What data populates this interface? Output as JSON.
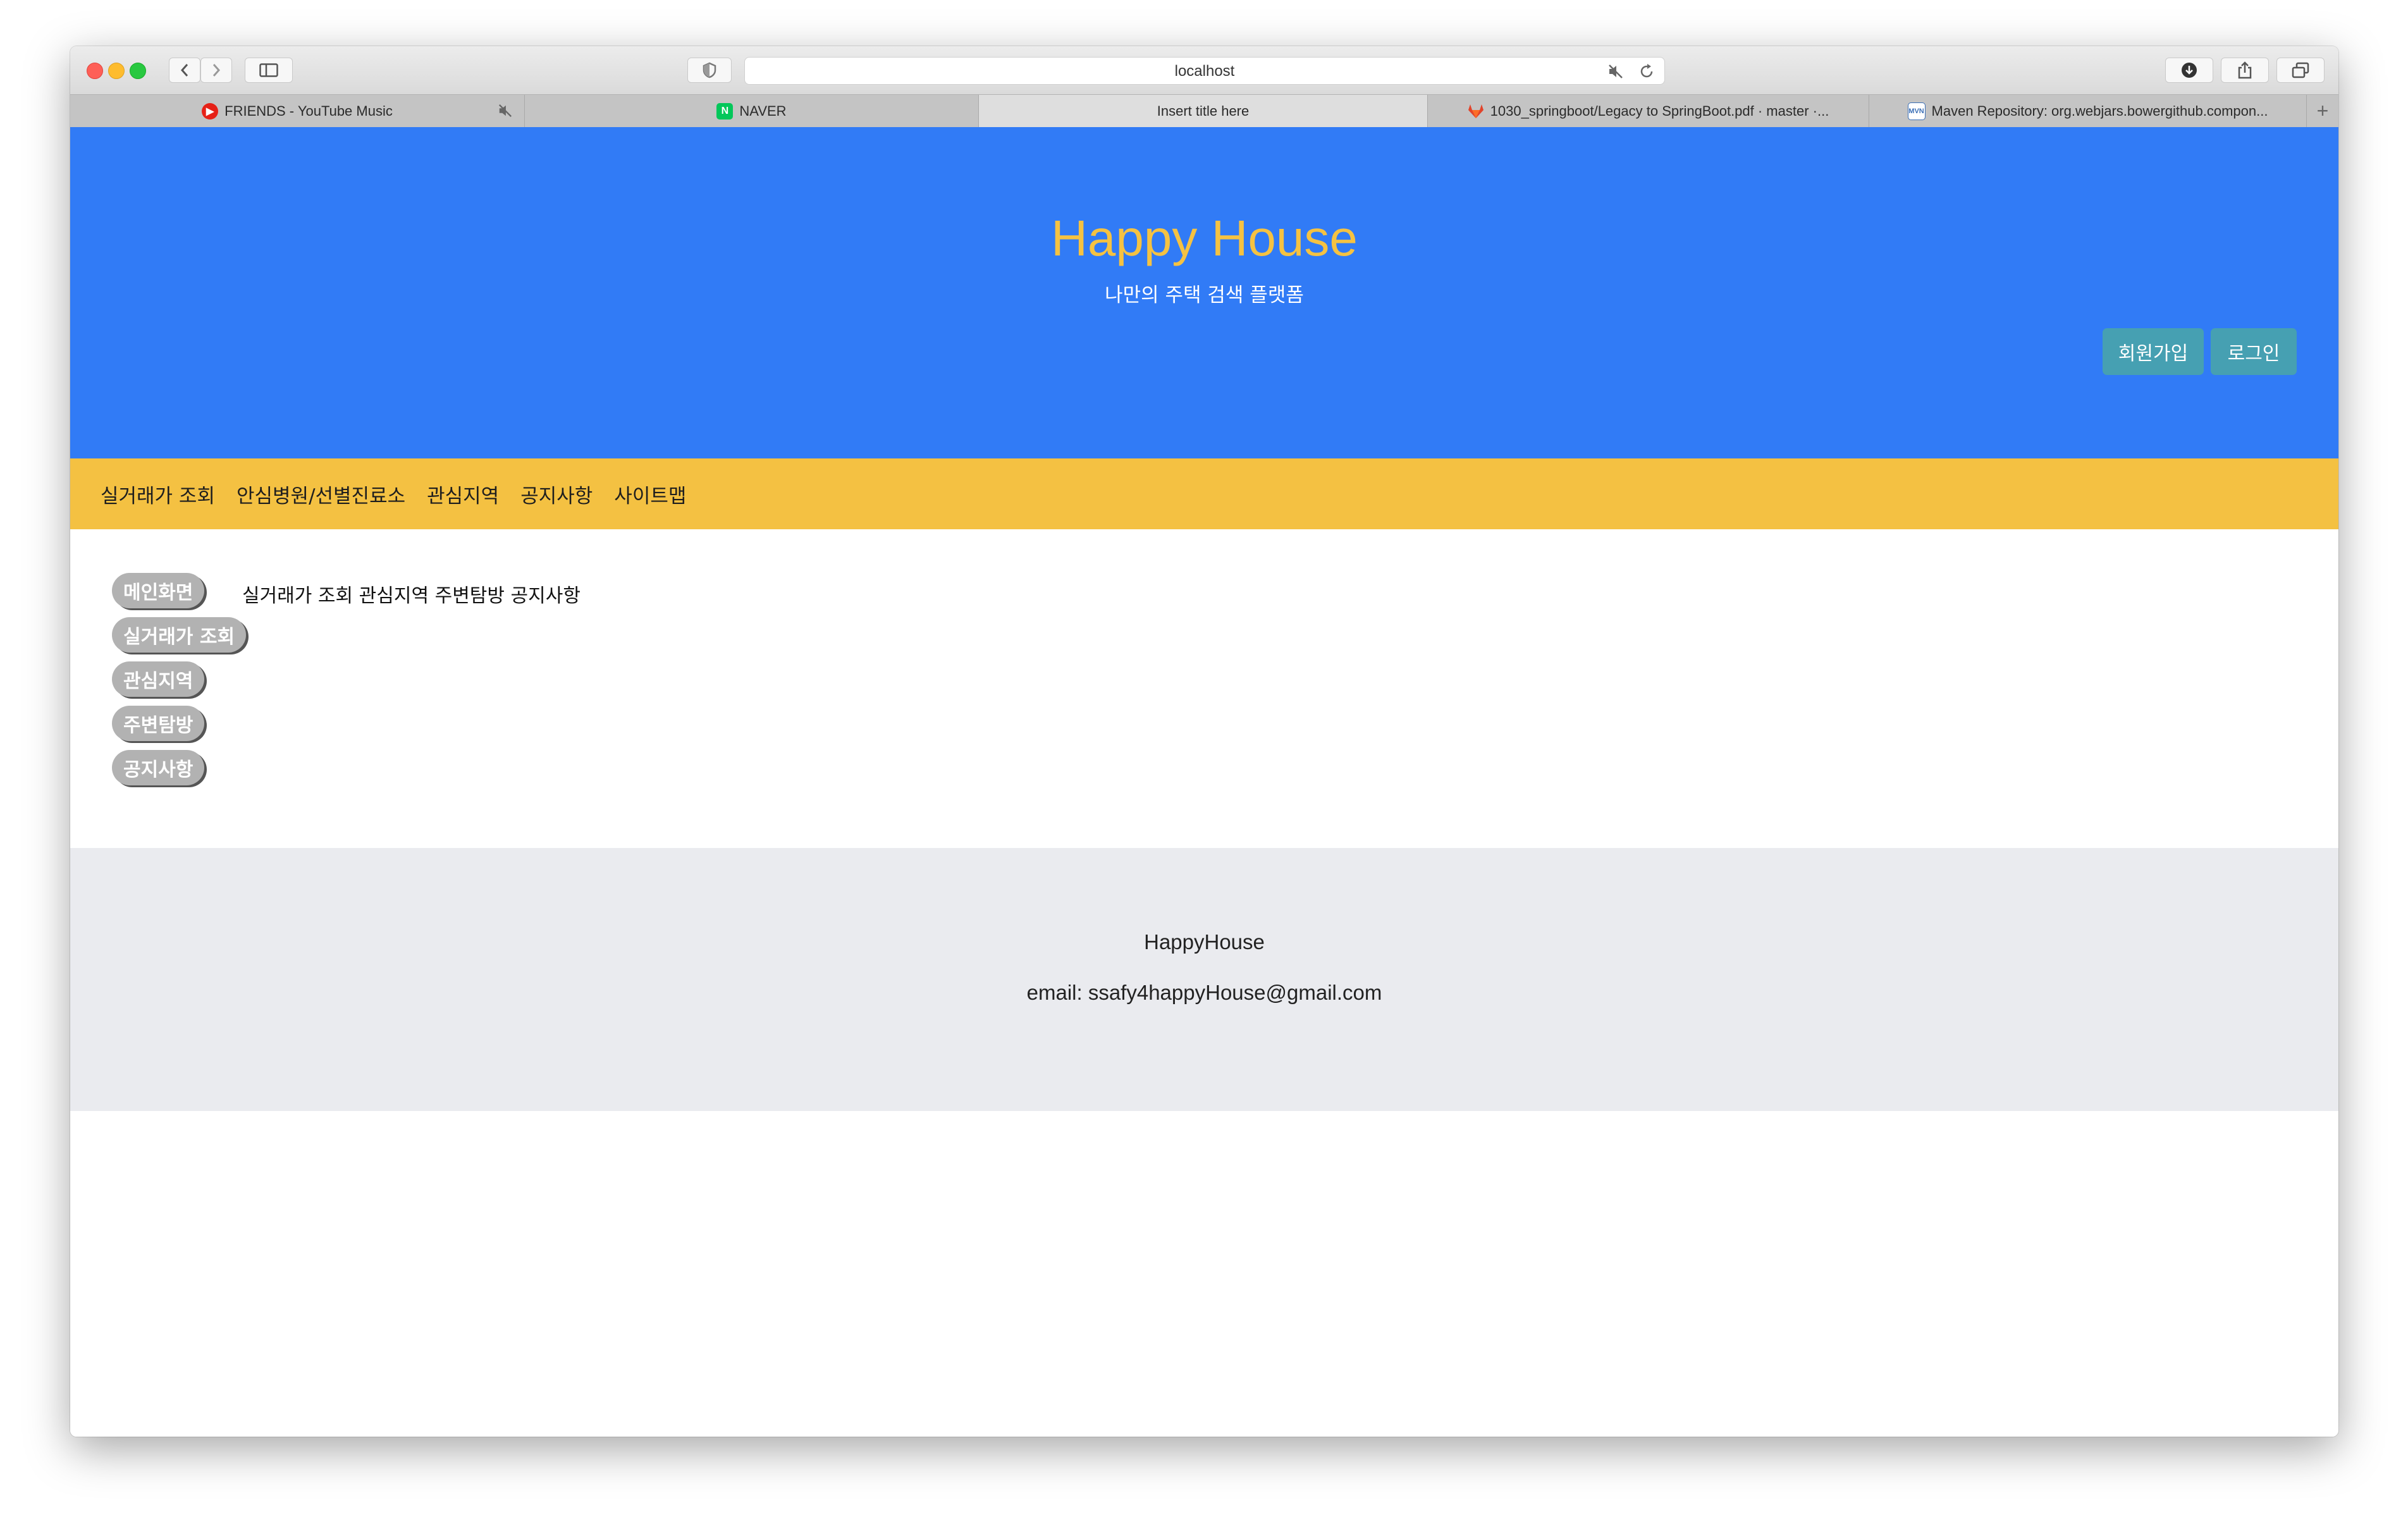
{
  "browser": {
    "address": "localhost",
    "tabs": [
      {
        "label": "FRIENDS - YouTube Music",
        "icon": "youtube-music-icon",
        "muted": true
      },
      {
        "label": "NAVER",
        "icon": "naver-icon"
      },
      {
        "label": "Insert title here",
        "active": true
      },
      {
        "label": "1030_springboot/Legacy to SpringBoot.pdf · master ·...",
        "icon": "gitlab-icon"
      },
      {
        "label": "Maven Repository: org.webjars.bowergithub.compon...",
        "icon": "mvn-icon"
      }
    ]
  },
  "header": {
    "title": "Happy House",
    "subtitle": "나만의 주택 검색 플랫폼",
    "signup_label": "회원가입",
    "login_label": "로그인"
  },
  "nav": {
    "items": [
      "실거래가 조회",
      "안심병원/선별진료소",
      "관심지역",
      "공지사항",
      "사이트맵"
    ]
  },
  "content": {
    "buttons": [
      "메인화면",
      "실거래가 조회",
      "관심지역",
      "주변탐방",
      "공지사항"
    ],
    "text": "실거래가 조회 관심지역 주변탐방 공지사항"
  },
  "footer": {
    "name": "HappyHouse",
    "email": "email: ssafy4happyHouse@gmail.com"
  },
  "colors": {
    "hero": "#317bf6",
    "title": "#f5c242",
    "nav": "#f4c142",
    "button": "#46a0b2",
    "footer": "#eaebef"
  }
}
